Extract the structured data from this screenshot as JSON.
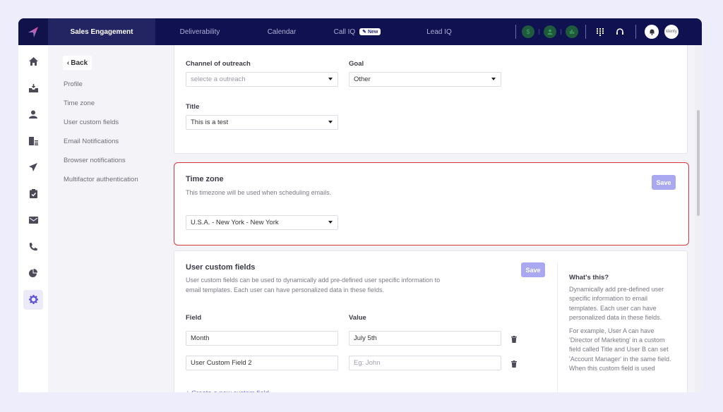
{
  "topnav": {
    "tabs": [
      {
        "label": "Sales Engagement",
        "active": true
      },
      {
        "label": "Deliverability",
        "active": false
      },
      {
        "label": "Calendar",
        "active": false
      },
      {
        "label": "Call IQ",
        "active": false,
        "badge": "New"
      },
      {
        "label": "Lead IQ",
        "active": false
      }
    ],
    "status_icons": [
      "dollar-icon",
      "user-icon",
      "chart-icon"
    ],
    "right_icons": [
      "dialpad-icon",
      "headset-icon",
      "bell-icon"
    ],
    "avatar_text": "klenty"
  },
  "rail": {
    "items": [
      {
        "icon": "home-icon"
      },
      {
        "icon": "inbox-icon"
      },
      {
        "icon": "prospects-icon"
      },
      {
        "icon": "accounts-icon"
      },
      {
        "icon": "send-icon"
      },
      {
        "icon": "tasks-icon"
      },
      {
        "icon": "mail-icon"
      },
      {
        "icon": "phone-icon"
      },
      {
        "icon": "reports-icon"
      },
      {
        "icon": "settings-icon",
        "active": true
      }
    ]
  },
  "subnav": {
    "back_label": "Back",
    "items": [
      "Profile",
      "Time zone",
      "User custom fields",
      "Email Notifications",
      "Browser notifications",
      "Multifactor authentication"
    ]
  },
  "profile_card": {
    "channel_label": "Channel of outreach",
    "channel_placeholder": "selecte a outreach",
    "goal_label": "Goal",
    "goal_value": "Other",
    "title_label": "Title",
    "title_value": "This is a test"
  },
  "timezone_card": {
    "heading": "Time zone",
    "description": "This timezone will be used when scheduling emails.",
    "save_label": "Save",
    "selected": "U.S.A. - New York - New York",
    "highlight_color": "#d6363e"
  },
  "custom_fields_card": {
    "heading": "User custom fields",
    "description_line1": "User custom fields can be used to dynamically add pre-defined user specific information to",
    "description_line2": "email templates. Each user can have personalized data in these fields.",
    "save_label": "Save",
    "field_header": "Field",
    "value_header": "Value",
    "rows": [
      {
        "field": "Month",
        "value": "July 5th",
        "value_placeholder": ""
      },
      {
        "field": "User Custom Field 2",
        "value": "",
        "value_placeholder": "Eg: John"
      }
    ],
    "create_link": "+ Create a new custom field",
    "aside": {
      "title": "What's this?",
      "para1": "Dynamically add pre-defined user specific information to email templates. Each user can have personalized data in these fields.",
      "para2": "For example, User A can have 'Director of Marketing' in a custom field called Title and User B can set 'Account Manager' in the same field. When this custom field is used"
    }
  },
  "colors": {
    "nav_bg": "#0f1150",
    "accent": "#aaa8f0",
    "link": "#6f6bd6"
  }
}
